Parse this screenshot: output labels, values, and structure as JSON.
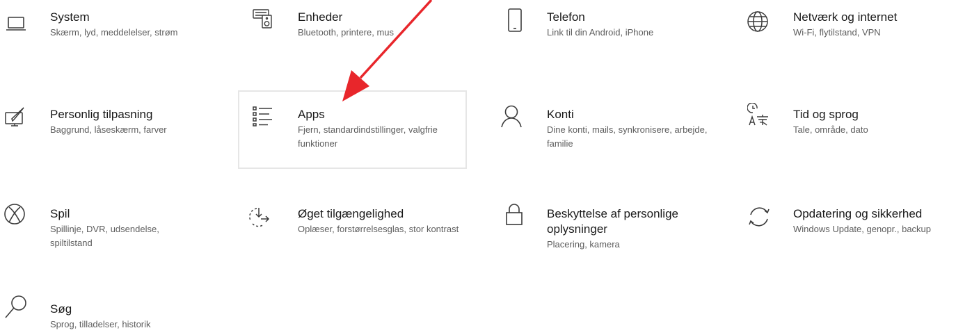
{
  "settings": {
    "tiles": [
      {
        "title": "System",
        "desc": "Skærm, lyd, meddelelser, strøm",
        "icon": "laptop-icon"
      },
      {
        "title": "Enheder",
        "desc": "Bluetooth, printere, mus",
        "icon": "keyboard-speaker-icon"
      },
      {
        "title": "Telefon",
        "desc": "Link til din Android, iPhone",
        "icon": "phone-icon"
      },
      {
        "title": "Netværk og internet",
        "desc": "Wi-Fi, flytilstand, VPN",
        "icon": "globe-icon"
      },
      {
        "title": "Personlig tilpasning",
        "desc": "Baggrund, låseskærm, farver",
        "icon": "paintbrush-icon"
      },
      {
        "title": "Apps",
        "desc": "Fjern, standardindstillinger, valgfrie funktioner",
        "icon": "apps-list-icon"
      },
      {
        "title": "Konti",
        "desc": "Dine konti, mails, synkronisere, arbejde, familie",
        "icon": "person-icon"
      },
      {
        "title": "Tid og sprog",
        "desc": "Tale, område, dato",
        "icon": "time-language-icon"
      },
      {
        "title": "Spil",
        "desc": "Spillinje, DVR, udsendelse, spiltilstand",
        "icon": "xbox-icon"
      },
      {
        "title": "Øget tilgængelighed",
        "desc": "Oplæser, forstørrelsesglas, stor kontrast",
        "icon": "ease-of-access-icon"
      },
      {
        "title": "Beskyttelse af personlige oplysninger",
        "desc": "Placering, kamera",
        "icon": "lock-icon"
      },
      {
        "title": "Opdatering og sikkerhed",
        "desc": "Windows Update, genopr., backup",
        "icon": "sync-icon"
      },
      {
        "title": "Søg",
        "desc": "Sprog, tilladelser, historik",
        "icon": "search-icon"
      }
    ]
  },
  "colors": {
    "annotation_arrow": "#e8262b",
    "icon_stroke": "#3b3b3b",
    "highlight_border": "#e6e6e6"
  }
}
